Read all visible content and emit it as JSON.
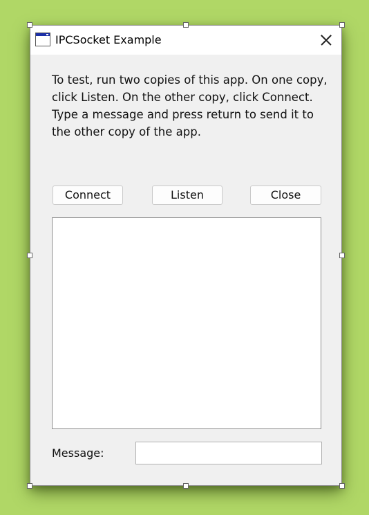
{
  "window": {
    "title": "IPCSocket Example",
    "icon": "window-app-icon",
    "close_icon": "close-icon"
  },
  "instructions": "To test, run two copies of this app.  On one copy, click Listen. On the other copy, click Connect. Type a message and press return to send it to the other copy of the app.",
  "buttons": {
    "connect": "Connect",
    "listen": "Listen",
    "close": "Close"
  },
  "log": {
    "content": ""
  },
  "message": {
    "label": "Message:",
    "value": "",
    "placeholder": ""
  },
  "colors": {
    "desktop_background": "#b0d766",
    "window_background": "#f0f0f0",
    "titlebar": "#ffffff"
  }
}
